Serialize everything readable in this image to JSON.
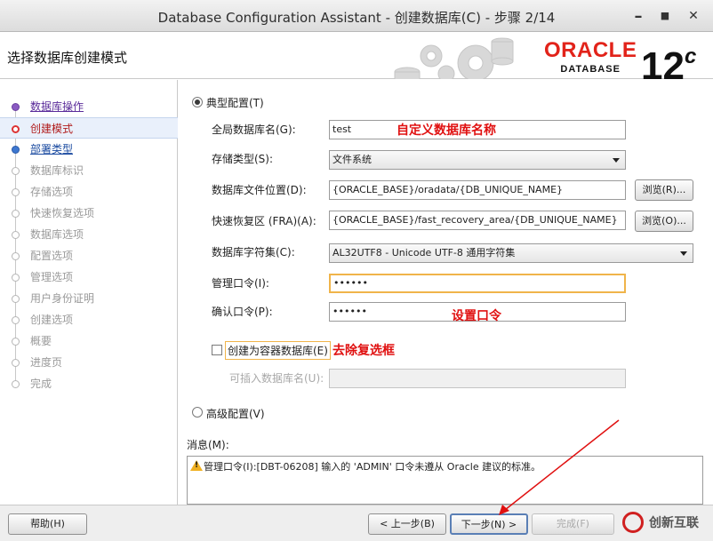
{
  "window": {
    "title": "Database Configuration Assistant - 创建数据库(C) - 步骤 2/14",
    "minimize": "✕",
    "maximize": "■",
    "close": "✕"
  },
  "header": {
    "step_title": "选择数据库创建模式",
    "brand": {
      "oracle": "ORACLE",
      "database": "DATABASE",
      "version": "12",
      "version_sup": "c"
    }
  },
  "sidebar": {
    "steps": [
      {
        "label": "数据库操作",
        "state": "done"
      },
      {
        "label": "创建模式",
        "state": "current"
      },
      {
        "label": "部署类型",
        "state": "next"
      },
      {
        "label": "数据库标识",
        "state": "pending"
      },
      {
        "label": "存储选项",
        "state": "pending"
      },
      {
        "label": "快速恢复选项",
        "state": "pending"
      },
      {
        "label": "数据库选项",
        "state": "pending"
      },
      {
        "label": "配置选项",
        "state": "pending"
      },
      {
        "label": "管理选项",
        "state": "pending"
      },
      {
        "label": "用户身份证明",
        "state": "pending"
      },
      {
        "label": "创建选项",
        "state": "pending"
      },
      {
        "label": "概要",
        "state": "pending"
      },
      {
        "label": "进度页",
        "state": "pending"
      },
      {
        "label": "完成",
        "state": "pending"
      }
    ]
  },
  "form": {
    "typical_config": {
      "label": "典型配置(T)",
      "selected": true
    },
    "global_db_name": {
      "label": "全局数据库名(G):",
      "value": "test"
    },
    "storage_type": {
      "label": "存储类型(S):",
      "value": "文件系统"
    },
    "db_file_location": {
      "label": "数据库文件位置(D):",
      "value": "{ORACLE_BASE}/oradata/{DB_UNIQUE_NAME}",
      "browse": "浏览(R)..."
    },
    "fra": {
      "label": "快速恢复区 (FRA)(A):",
      "value": "{ORACLE_BASE}/fast_recovery_area/{DB_UNIQUE_NAME}",
      "browse": "浏览(O)..."
    },
    "charset": {
      "label": "数据库字符集(C):",
      "value": "AL32UTF8 - Unicode UTF-8 通用字符集"
    },
    "admin_password": {
      "label": "管理口令(I):",
      "value": "••••••"
    },
    "confirm_password": {
      "label": "确认口令(P):",
      "value": "••••••"
    },
    "container_db": {
      "label": "创建为容器数据库(E)",
      "checked": false
    },
    "pluggable_db_name": {
      "label": "可插入数据库名(U):",
      "value": ""
    },
    "advanced_config": {
      "label": "高级配置(V)",
      "selected": false
    }
  },
  "annotations": {
    "custom_db_name": "自定义数据库名称",
    "set_password": "设置口令",
    "remove_checkbox": "去除复选框"
  },
  "messages": {
    "label": "消息(M):",
    "text": "管理口令(I):[DBT-06208] 输入的 'ADMIN' 口令未遵从 Oracle 建议的标准。"
  },
  "footer": {
    "help": "帮助(H)",
    "back": "< 上一步(B)",
    "next": "下一步(N) >",
    "finish": "完成(F)"
  },
  "watermark": {
    "text": "创新互联"
  },
  "colors": {
    "annotation": "#e01010",
    "oracle_red": "#e2231a",
    "focus_border": "#f0b44a"
  }
}
